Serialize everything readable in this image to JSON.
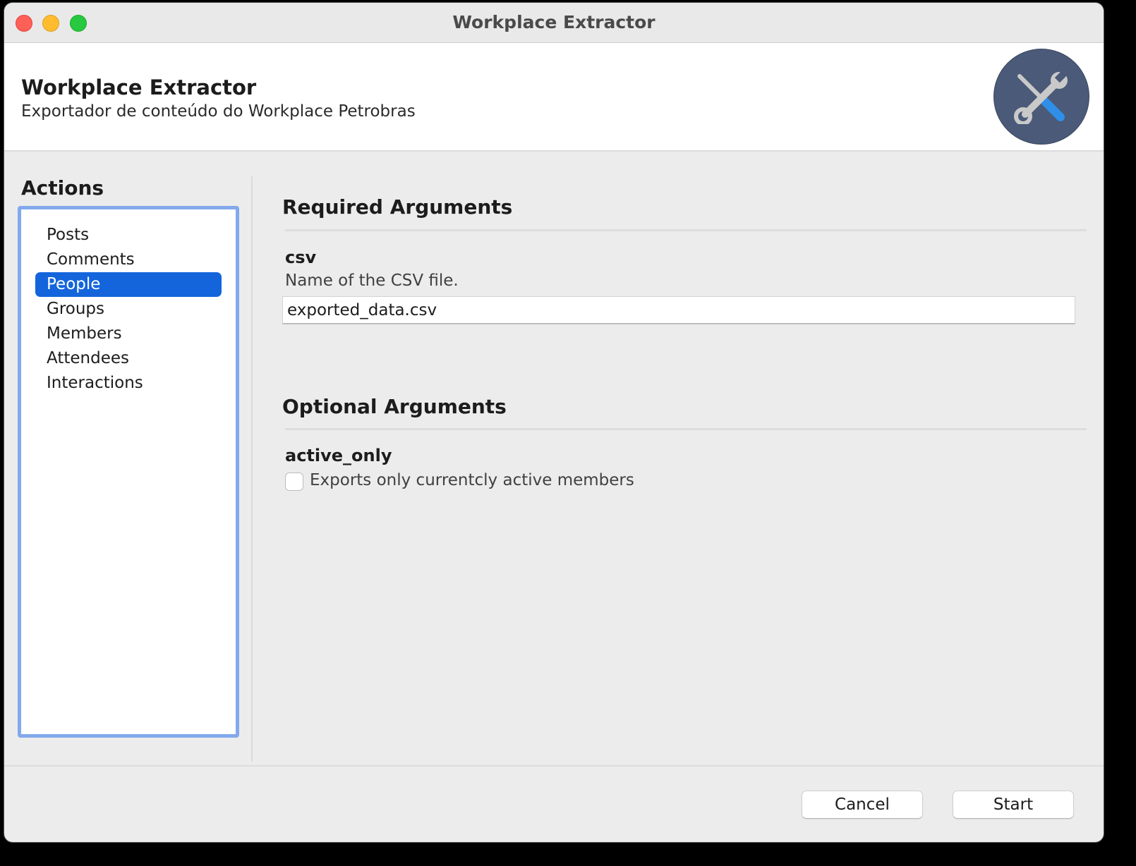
{
  "window": {
    "title": "Workplace Extractor"
  },
  "header": {
    "app_name": "Workplace Extractor",
    "subtitle": "Exportador de conteúdo do Workplace Petrobras",
    "logo_icon": "tools-icon"
  },
  "actions": {
    "title": "Actions",
    "items": [
      {
        "label": "Posts",
        "selected": false
      },
      {
        "label": "Comments",
        "selected": false
      },
      {
        "label": "People",
        "selected": true
      },
      {
        "label": "Groups",
        "selected": false
      },
      {
        "label": "Members",
        "selected": false
      },
      {
        "label": "Attendees",
        "selected": false
      },
      {
        "label": "Interactions",
        "selected": false
      }
    ]
  },
  "required": {
    "title": "Required Arguments",
    "csv": {
      "name": "csv",
      "description": "Name of the CSV file.",
      "value": "exported_data.csv"
    }
  },
  "optional": {
    "title": "Optional Arguments",
    "active_only": {
      "name": "active_only",
      "description": "Exports only currentcly active members",
      "checked": false
    }
  },
  "footer": {
    "cancel_label": "Cancel",
    "start_label": "Start"
  },
  "colors": {
    "selection": "#1465dc",
    "list_focus_ring": "#82a9ec",
    "logo_background": "#4a5a78"
  }
}
